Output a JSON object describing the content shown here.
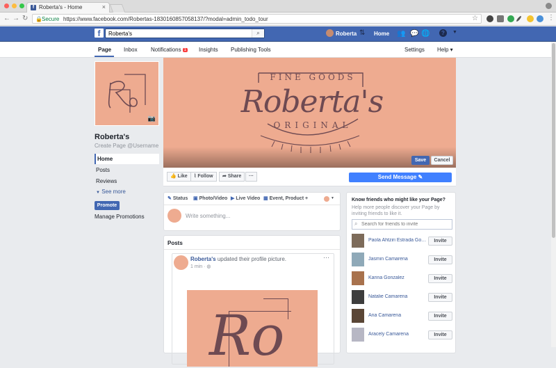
{
  "browser": {
    "tab_title": "Roberta's - Home",
    "tab_close": "×",
    "secure_label": "Secure",
    "url": "https://www.facebook.com/Robertas-1830160857058137/?modal=admin_todo_tour"
  },
  "fb_bar": {
    "search_value": "Roberta's",
    "profile_name": "Roberta",
    "home_label": "Home"
  },
  "page_nav": {
    "tabs": [
      {
        "label": "Page"
      },
      {
        "label": "Inbox"
      },
      {
        "label": "Notifications",
        "badge": "1"
      },
      {
        "label": "Insights"
      },
      {
        "label": "Publishing Tools"
      }
    ],
    "settings": "Settings",
    "help": "Help ▾"
  },
  "sidebar": {
    "page_name": "Roberta's",
    "username_link": "Create Page @Username",
    "items": [
      {
        "label": "Home"
      },
      {
        "label": "Posts"
      },
      {
        "label": "Reviews"
      }
    ],
    "see_more": "See more",
    "promote": "Promote",
    "manage_promotions": "Manage Promotions"
  },
  "cover": {
    "line1": "FINE GOODS",
    "line2": "Roberta's",
    "line3": "ORIGINAL",
    "save": "Save",
    "cancel": "Cancel"
  },
  "actions": {
    "like": "Like",
    "follow": "Follow",
    "share": "Share",
    "more": "···",
    "send_message": "Send Message"
  },
  "composer": {
    "status": "Status",
    "photo_video": "Photo/Video",
    "live_video": "Live Video",
    "event_product": "Event, Product +",
    "placeholder": "Write something..."
  },
  "posts": {
    "title": "Posts",
    "author": "Roberta's",
    "action": "updated their profile picture.",
    "time": "1 min · ",
    "monogram": "Ro"
  },
  "invite": {
    "title": "Know friends who might like your Page?",
    "subtitle": "Help more people discover your Page by inviting friends to like it.",
    "search_placeholder": "Search for friends to invite",
    "button_label": "Invite",
    "friends": [
      {
        "name": "Paola Ahtziri Estrada Gon..."
      },
      {
        "name": "Jasmin Camarena"
      },
      {
        "name": "Karina Gonzalez"
      },
      {
        "name": "Natalie Camarena"
      },
      {
        "name": "Ana Camarena"
      },
      {
        "name": "Aracely Camarena"
      }
    ]
  },
  "colors": {
    "fb_blue": "#4267b2",
    "brand_peach": "#eeab90",
    "logo_ink": "#6e4a52",
    "link_blue": "#385898",
    "messenger_blue": "#4080ff"
  }
}
